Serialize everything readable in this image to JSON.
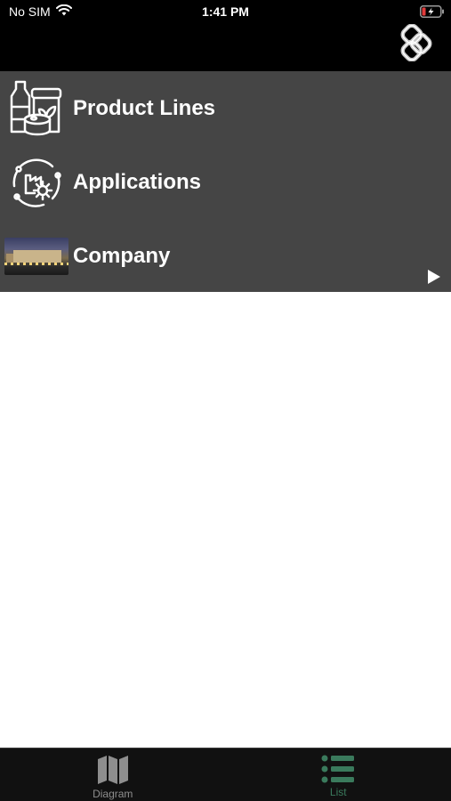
{
  "status_bar": {
    "carrier": "No SIM",
    "time": "1:41 PM",
    "wifi_icon": "wifi-icon",
    "battery_icon": "battery-charging-icon"
  },
  "header": {
    "logo_icon": "chain-link-logo-icon"
  },
  "list": {
    "background": "#454545",
    "items": [
      {
        "label": "Product Lines",
        "icon": "product-containers-icon"
      },
      {
        "label": "Applications",
        "icon": "factory-gear-icon"
      },
      {
        "label": "Company",
        "icon": "company-building-photo",
        "disclosure_icon": "play-icon"
      }
    ]
  },
  "tabbar": {
    "tabs": [
      {
        "label": "Diagram",
        "icon": "map-icon",
        "selected": false,
        "color": "#8e8e8e"
      },
      {
        "label": "List",
        "icon": "list-icon",
        "selected": true,
        "color": "#3a7a5c"
      }
    ]
  }
}
